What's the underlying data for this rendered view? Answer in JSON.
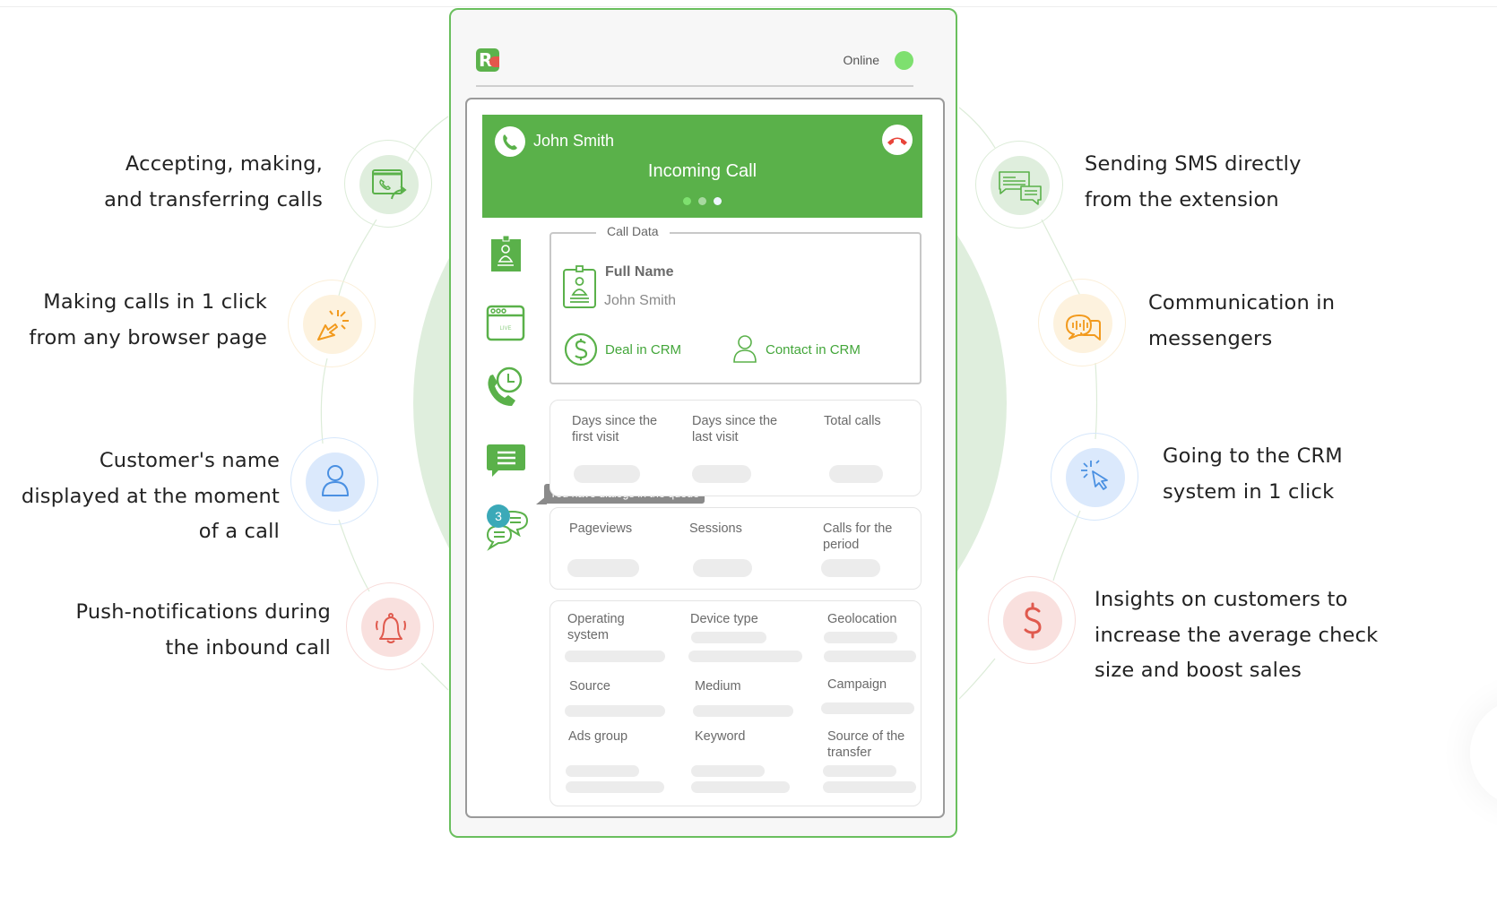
{
  "extension": {
    "status_label": "Online",
    "status_color": "#7ee06f",
    "brand_color": "#5ab14a",
    "call": {
      "caller_name": "John Smith",
      "status": "Incoming Call",
      "carousel_dots": 3,
      "active_dot": 3
    },
    "call_data": {
      "legend": "Call Data",
      "full_name_label": "Full Name",
      "full_name_value": "John Smith",
      "deal_link": "Deal in CRM",
      "contact_link": "Contact in CRM"
    },
    "visit_stats": [
      "Days since the first visit",
      "Days since the last visit",
      "Total calls"
    ],
    "session_stats": [
      "Pageviews",
      "Sessions",
      "Calls for the period"
    ],
    "visitor_info": {
      "row1": [
        "Operating system",
        "Device type",
        "Geolocation"
      ],
      "row2": [
        "Source",
        "Medium",
        "Campaign"
      ],
      "row3": [
        "Ads group",
        "Keyword",
        "Source of the transfer"
      ]
    },
    "sidebar_icons": [
      "contact-card-icon",
      "live-window-icon",
      "call-history-icon",
      "sms-icon",
      "dialogs-queue-icon"
    ],
    "queue_tooltip": "You have dialogs in the queue",
    "queue_count": "3",
    "live_label": "LIVE"
  },
  "features_left": [
    {
      "text": "Accepting, making,\nand transferring calls",
      "icon": "call-transfer-icon",
      "color": "#5ab14a"
    },
    {
      "text": "Making calls in 1 click\nfrom any browser page",
      "icon": "click-cursor-icon",
      "color": "#f29a1d"
    },
    {
      "text": "Customer's name\ndisplayed at the moment\nof a call",
      "icon": "user-icon",
      "color": "#4a90e2"
    },
    {
      "text": "Push-notifications during\nthe inbound call",
      "icon": "bell-icon",
      "color": "#e05a4e"
    }
  ],
  "features_right": [
    {
      "text": "Sending SMS directly\nfrom the extension",
      "icon": "sms-chat-icon",
      "color": "#5ab14a"
    },
    {
      "text": "Communication in\nmessengers",
      "icon": "voice-message-icon",
      "color": "#f29a1d"
    },
    {
      "text": "Going to the CRM\nsystem in 1 click",
      "icon": "click-cursor-icon",
      "color": "#4a90e2"
    },
    {
      "text": "Insights on customers to\nincrease the average check\nsize and boost sales",
      "icon": "dollar-icon",
      "color": "#e05a4e"
    }
  ]
}
